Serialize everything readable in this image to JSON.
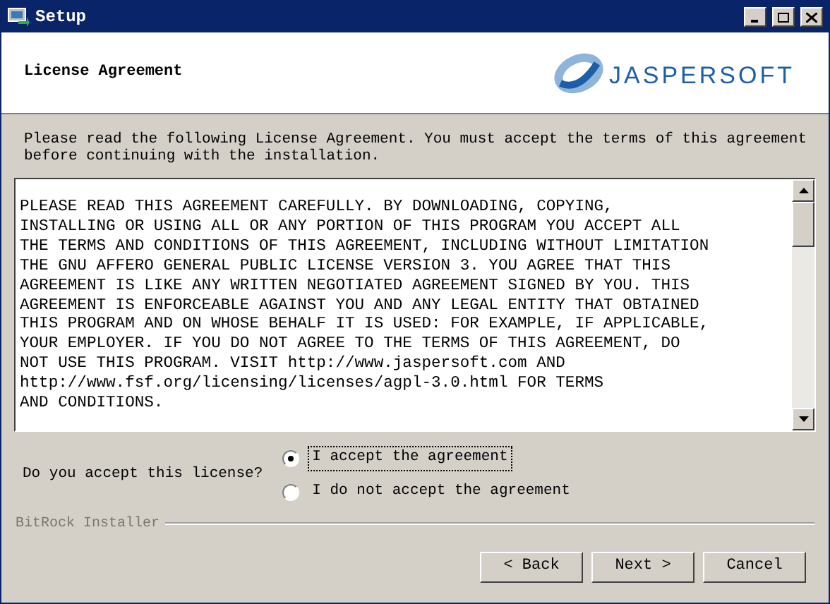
{
  "window": {
    "title": "Setup"
  },
  "header": {
    "title": "License Agreement",
    "logo_text": "JASPERSOFT"
  },
  "intro": "Please read the following License Agreement. You must accept the terms of this agreement\nbefore continuing with the installation.",
  "license": {
    "lines": [
      "PLEASE READ THIS AGREEMENT CAREFULLY. BY DOWNLOADING, COPYING,",
      "INSTALLING OR USING ALL OR ANY PORTION OF THIS PROGRAM YOU ACCEPT ALL",
      "THE TERMS AND CONDITIONS OF THIS AGREEMENT, INCLUDING WITHOUT LIMITATION",
      "THE GNU AFFERO GENERAL PUBLIC LICENSE VERSION 3. YOU AGREE THAT THIS",
      "AGREEMENT IS LIKE ANY WRITTEN NEGOTIATED AGREEMENT SIGNED BY YOU. THIS",
      "AGREEMENT IS ENFORCEABLE AGAINST YOU AND ANY LEGAL ENTITY THAT OBTAINED",
      "THIS PROGRAM AND ON WHOSE BEHALF IT IS USED: FOR EXAMPLE, IF APPLICABLE,",
      "YOUR EMPLOYER. IF YOU DO NOT AGREE TO THE TERMS OF THIS AGREEMENT, DO",
      "NOT USE THIS PROGRAM. VISIT http://www.jaspersoft.com AND",
      "http://www.fsf.org/licensing/licenses/agpl-3.0.html FOR TERMS",
      "AND CONDITIONS."
    ]
  },
  "question": "Do you accept this license?",
  "options": [
    {
      "label": "I accept the agreement",
      "selected": true
    },
    {
      "label": "I do not accept the agreement",
      "selected": false
    }
  ],
  "footer": {
    "brand": "BitRock Installer"
  },
  "buttons": [
    "< Back",
    "Next >",
    "Cancel"
  ]
}
